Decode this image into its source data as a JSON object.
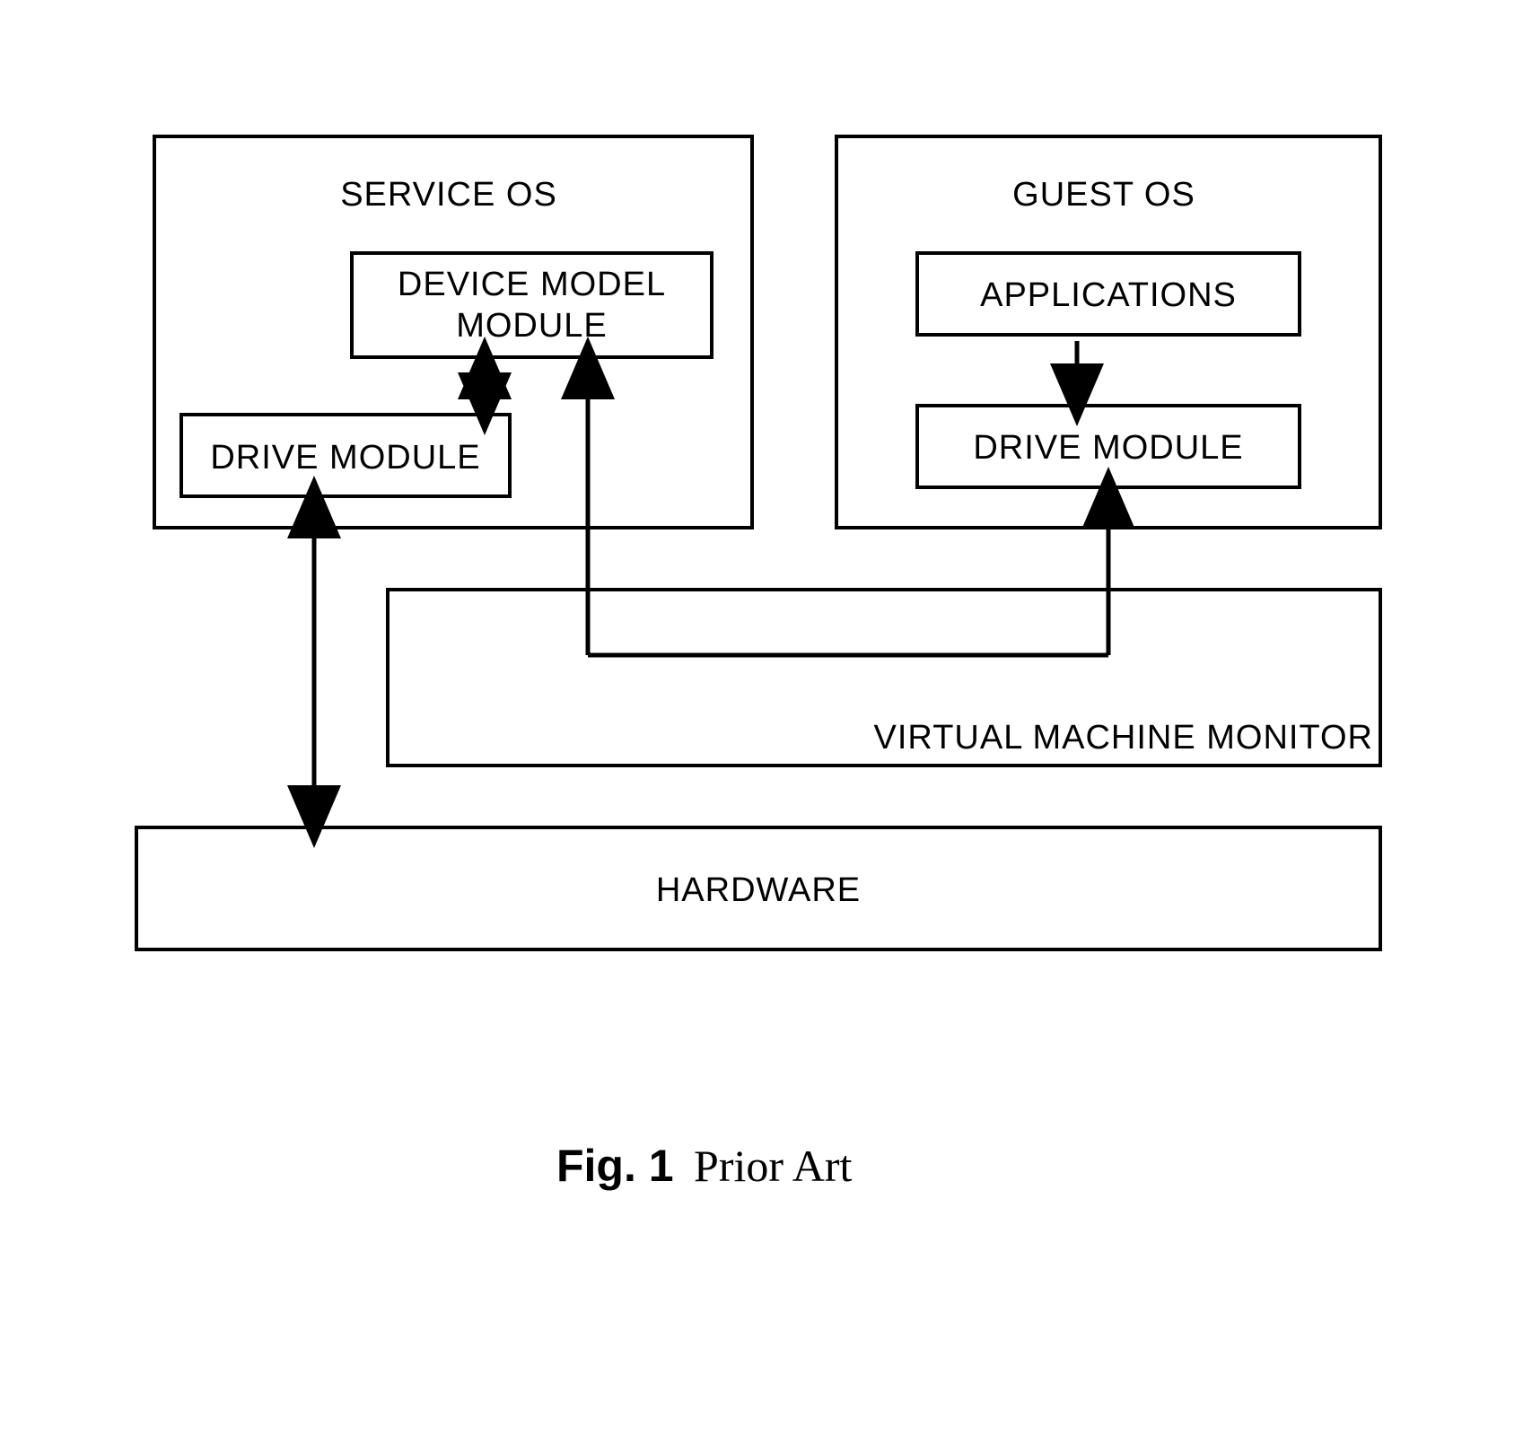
{
  "serviceOs": {
    "title": "SERVICE OS",
    "deviceModel": "DEVICE MODEL MODULE",
    "driveModule": "DRIVE MODULE"
  },
  "guestOs": {
    "title": "GUEST OS",
    "applications": "APPLICATIONS",
    "driveModule": "DRIVE MODULE"
  },
  "vmm": "VIRTUAL MACHINE MONITOR",
  "hardware": "HARDWARE",
  "caption": {
    "fig": "Fig. 1",
    "priorArt": "Prior Art"
  }
}
